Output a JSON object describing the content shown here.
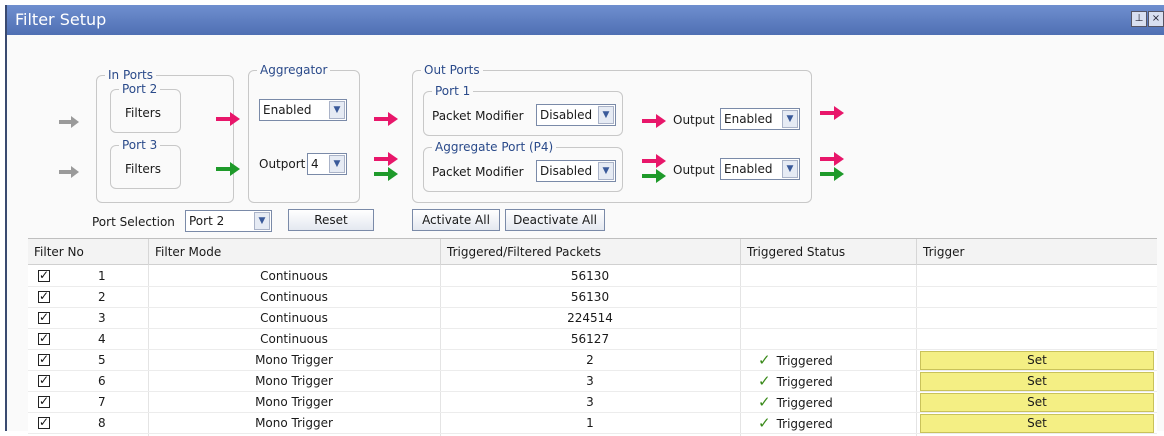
{
  "window": {
    "title": "Filter Setup",
    "pin_icon": "pin-icon",
    "close_icon": "close-icon"
  },
  "colors": {
    "red_arrow": "#e8166a",
    "green_arrow": "#1e9a2a",
    "gray_arrow": "#9a9a9a",
    "trigger_bg": "#f4ef84"
  },
  "in_ports": {
    "title": "In Ports",
    "port2": {
      "title": "Port 2",
      "filters": "Filters"
    },
    "port3": {
      "title": "Port 3",
      "filters": "Filters"
    }
  },
  "aggregator": {
    "title": "Aggregator",
    "state": "Enabled",
    "outport_label": "Outport",
    "outport_value": "4"
  },
  "out_ports": {
    "title": "Out Ports",
    "port1": {
      "title": "Port 1",
      "modifier_label": "Packet Modifier",
      "modifier_value": "Disabled",
      "output_label": "Output",
      "output_value": "Enabled"
    },
    "aggregate": {
      "title": "Aggregate Port (P4)",
      "modifier_label": "Packet Modifier",
      "modifier_value": "Disabled",
      "output_label": "Output",
      "output_value": "Enabled"
    }
  },
  "controls": {
    "port_selection_label": "Port Selection",
    "port_selection_value": "Port 2",
    "reset": "Reset",
    "activate_all": "Activate All",
    "deactivate_all": "Deactivate All"
  },
  "table": {
    "columns": [
      "Filter No",
      "Filter Mode",
      "Triggered/Filtered Packets",
      "Triggered Status",
      "Trigger"
    ],
    "rows": [
      {
        "checked": true,
        "no": "1",
        "mode": "Continuous",
        "packets": "56130",
        "status": "",
        "trigger": ""
      },
      {
        "checked": true,
        "no": "2",
        "mode": "Continuous",
        "packets": "56130",
        "status": "",
        "trigger": ""
      },
      {
        "checked": true,
        "no": "3",
        "mode": "Continuous",
        "packets": "224514",
        "status": "",
        "trigger": ""
      },
      {
        "checked": true,
        "no": "4",
        "mode": "Continuous",
        "packets": "56127",
        "status": "",
        "trigger": ""
      },
      {
        "checked": true,
        "no": "5",
        "mode": "Mono Trigger",
        "packets": "2",
        "status": "Triggered",
        "trigger": "Set"
      },
      {
        "checked": true,
        "no": "6",
        "mode": "Mono Trigger",
        "packets": "3",
        "status": "Triggered",
        "trigger": "Set"
      },
      {
        "checked": true,
        "no": "7",
        "mode": "Mono Trigger",
        "packets": "3",
        "status": "Triggered",
        "trigger": "Set"
      },
      {
        "checked": true,
        "no": "8",
        "mode": "Mono Trigger",
        "packets": "1",
        "status": "Triggered",
        "trigger": "Set"
      }
    ]
  }
}
